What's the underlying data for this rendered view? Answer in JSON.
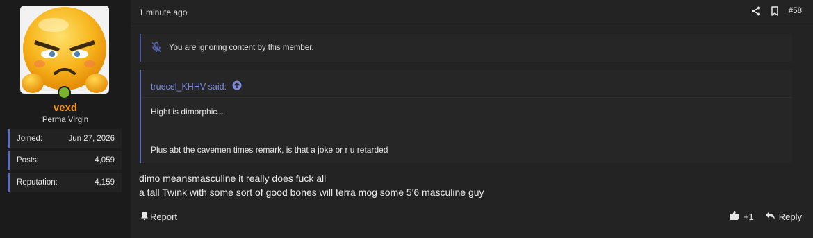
{
  "user": {
    "username": "vexd",
    "title": "Perma Virgin",
    "stats": [
      {
        "label": "Joined:",
        "value": "Jun 27, 2026"
      },
      {
        "label": "Posts:",
        "value": "4,059"
      },
      {
        "label": "Reputation:",
        "value": "4,159"
      }
    ],
    "status_color": "#7ab32e",
    "name_color": "#f29312"
  },
  "post": {
    "time": "1 minute ago",
    "number": "#58",
    "ignored_notice": "You are ignoring content by this member.",
    "quote": {
      "author": "truecel_KHHV said:",
      "line1": "Hight is dimorphic...",
      "line2": "Plus abt the cavemen times remark, is that a joke or r u retarded"
    },
    "message": [
      "dimo meansmasculine it really does fuck all",
      "a tall Twink with some sort of good bones will terra mog some 5'6 masculine guy"
    ]
  },
  "footer": {
    "report_label": "Report",
    "like_count": "+1",
    "reply_label": "Reply"
  },
  "icons": {
    "share": "share-icon",
    "bookmark": "bookmark-icon",
    "muted": "mic-off-icon",
    "quote_arrow": "arrow-up-circle-icon",
    "report": "flag-icon",
    "like": "thumbs-up-icon",
    "reply": "reply-icon"
  }
}
